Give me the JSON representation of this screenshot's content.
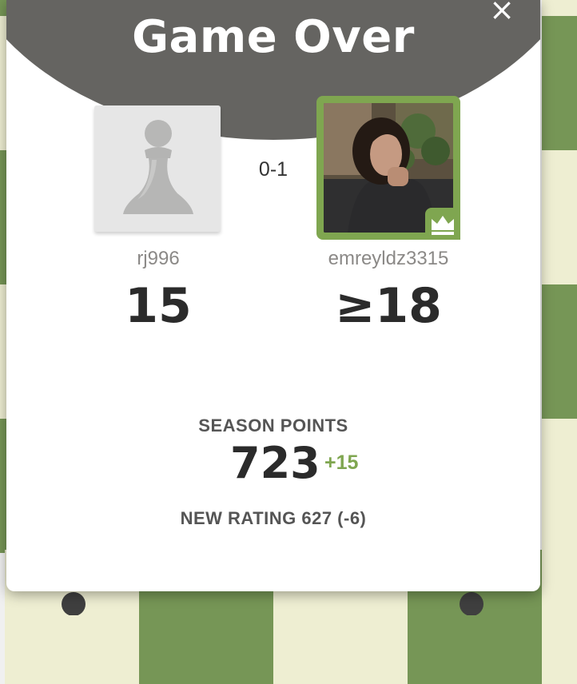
{
  "modal": {
    "title": "Game Over",
    "close_icon": "×"
  },
  "result": {
    "score": "0-1"
  },
  "players": [
    {
      "username": "rj996",
      "rating": "15",
      "avatar": "pawn-icon"
    },
    {
      "username": "emreyldz3315",
      "rating": "≥18",
      "avatar": "profile-photo",
      "badge": "crown-icon"
    }
  ],
  "season": {
    "label": "SEASON POINTS",
    "points": "723",
    "delta": "+15"
  },
  "new_rating": "NEW RATING 627 (-6)",
  "colors": {
    "header": "#656461",
    "accent_green": "#7fa650",
    "board_dark": "#769656",
    "board_light": "#eeeed2"
  }
}
